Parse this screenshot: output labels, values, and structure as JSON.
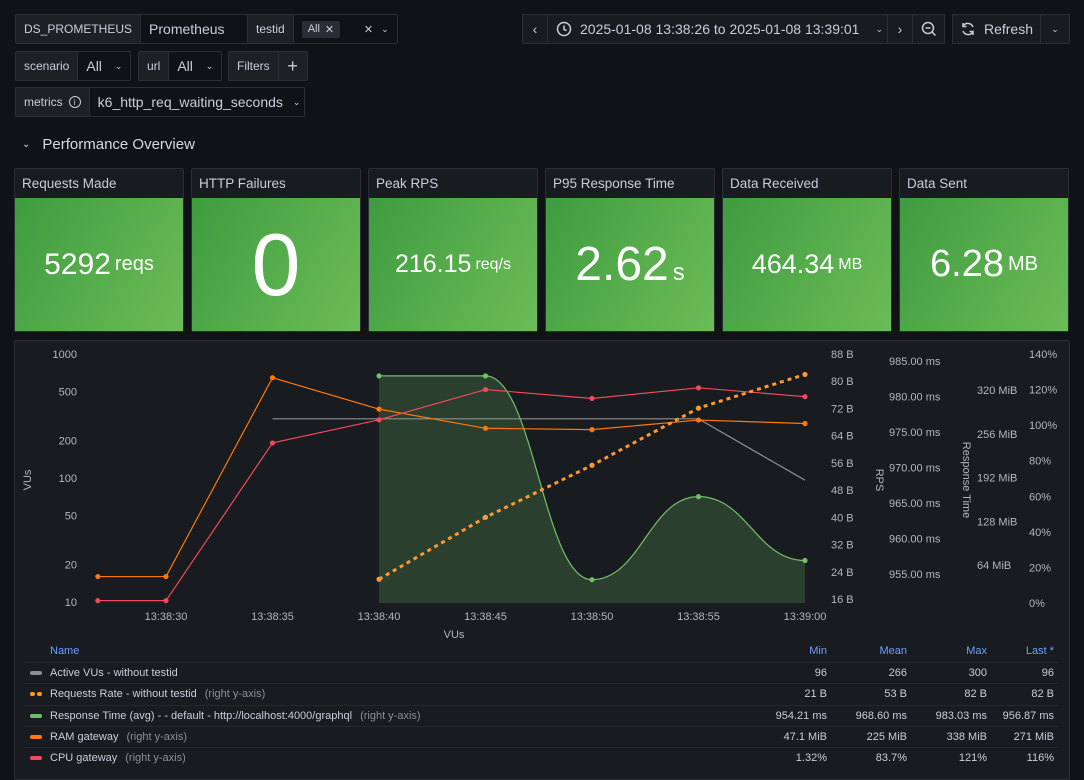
{
  "variables": {
    "ds": {
      "label": "DS_PROMETHEUS",
      "value": "Prometheus"
    },
    "testid": {
      "label": "testid",
      "value": "All"
    },
    "scenario": {
      "label": "scenario",
      "value": "All"
    },
    "url": {
      "label": "url",
      "value": "All"
    },
    "filters": {
      "label": "Filters",
      "add": "+"
    },
    "metrics": {
      "label": "metrics",
      "value": "k6_http_req_waiting_seconds"
    }
  },
  "toolbar": {
    "time_range": "2025-01-08 13:38:26 to 2025-01-08 13:39:01",
    "refresh_label": "Refresh"
  },
  "section": {
    "title": "Performance Overview"
  },
  "stats": [
    {
      "title": "Requests Made",
      "value": "5292",
      "unit": "reqs"
    },
    {
      "title": "HTTP Failures",
      "value": "0",
      "unit": ""
    },
    {
      "title": "Peak RPS",
      "value": "216.15",
      "unit": "req/s"
    },
    {
      "title": "P95 Response Time",
      "value": "2.62",
      "unit": "s"
    },
    {
      "title": "Data Received",
      "value": "464.34",
      "unit": "MB"
    },
    {
      "title": "Data Sent",
      "value": "6.28",
      "unit": "MB"
    }
  ],
  "colors": {
    "stat_green": "#56ac4b",
    "vus": "#8e8e8e",
    "rps": "#ff9830",
    "response": "#73bf69",
    "ram": "#ff780a",
    "cpu": "#f2495c"
  },
  "chart_data": {
    "type": "line",
    "x": [
      "13:38:27",
      "13:38:30",
      "13:38:35",
      "13:38:40",
      "13:38:45",
      "13:38:50",
      "13:38:55",
      "13:39:00"
    ],
    "x_ticks": [
      "13:38:30",
      "13:38:35",
      "13:38:40",
      "13:38:45",
      "13:38:50",
      "13:38:55",
      "13:39:00"
    ],
    "xlabel": "VUs",
    "axes": {
      "left": {
        "label": "VUs",
        "scale": "log",
        "ticks": [
          "10",
          "20",
          "50",
          "100",
          "200",
          "500",
          "1000"
        ],
        "range": [
          10,
          1000
        ]
      },
      "right_bytes": {
        "label": "RPS",
        "ticks": [
          "16 B",
          "24 B",
          "32 B",
          "40 B",
          "48 B",
          "56 B",
          "64 B",
          "72 B",
          "80 B",
          "88 B"
        ],
        "range": [
          16,
          88
        ]
      },
      "right_ms": {
        "label": "Response Time",
        "ticks": [
          "955.00 ms",
          "960.00 ms",
          "965.00 ms",
          "970.00 ms",
          "975.00 ms",
          "980.00 ms",
          "985.00 ms"
        ],
        "range": [
          953.5,
          986
        ]
      },
      "right_mib": {
        "label": "",
        "ticks": [
          "64 MiB",
          "128 MiB",
          "192 MiB",
          "256 MiB",
          "320 MiB"
        ],
        "range": [
          29,
          351
        ]
      },
      "right_pct": {
        "label": "",
        "ticks": [
          "0%",
          "20%",
          "40%",
          "60%",
          "80%",
          "100%",
          "120%",
          "140%"
        ],
        "range": [
          0,
          140
        ]
      }
    },
    "series": [
      {
        "name": "Active VUs - without testid",
        "axis": "left",
        "style": "solid",
        "values": [
          null,
          null,
          300,
          300,
          300,
          300,
          300,
          96
        ]
      },
      {
        "name": "Requests Rate - without testid",
        "axis": "right_bytes",
        "style": "dashed",
        "values": [
          null,
          null,
          null,
          21.8,
          40,
          55.3,
          72.1,
          82
        ]
      },
      {
        "name": "Response Time (avg) - - default - http://localhost:4000/graphql",
        "axis": "right_ms",
        "style": "area-smooth",
        "values": [
          null,
          null,
          null,
          982.9,
          982.9,
          954.2,
          965.9,
          956.9
        ]
      },
      {
        "name": "RAM gateway",
        "axis": "right_mib",
        "style": "solid",
        "values": [
          47.1,
          47.1,
          338,
          292,
          264,
          262,
          276,
          271
        ]
      },
      {
        "name": "CPU gateway",
        "axis": "right_pct",
        "style": "solid",
        "values": [
          1.32,
          1.32,
          90,
          103,
          120,
          115,
          121,
          116
        ]
      }
    ]
  },
  "legend": {
    "headers": [
      "Name",
      "Min",
      "Mean",
      "Max",
      "Last *"
    ],
    "rows": [
      {
        "name": "Active VUs - without testid",
        "sub": "",
        "min": "96",
        "mean": "266",
        "max": "300",
        "last": "96"
      },
      {
        "name": "Requests Rate - without testid",
        "sub": "(right y-axis)",
        "min": "21 B",
        "mean": "53 B",
        "max": "82 B",
        "last": "82 B"
      },
      {
        "name": "Response Time (avg) - - default - http://localhost:4000/graphql",
        "sub": "(right y-axis)",
        "min": "954.21 ms",
        "mean": "968.60 ms",
        "max": "983.03 ms",
        "last": "956.87 ms"
      },
      {
        "name": "RAM gateway",
        "sub": "(right y-axis)",
        "min": "47.1 MiB",
        "mean": "225 MiB",
        "max": "338 MiB",
        "last": "271 MiB"
      },
      {
        "name": "CPU gateway",
        "sub": "(right y-axis)",
        "min": "1.32%",
        "mean": "83.7%",
        "max": "121%",
        "last": "116%"
      }
    ]
  }
}
